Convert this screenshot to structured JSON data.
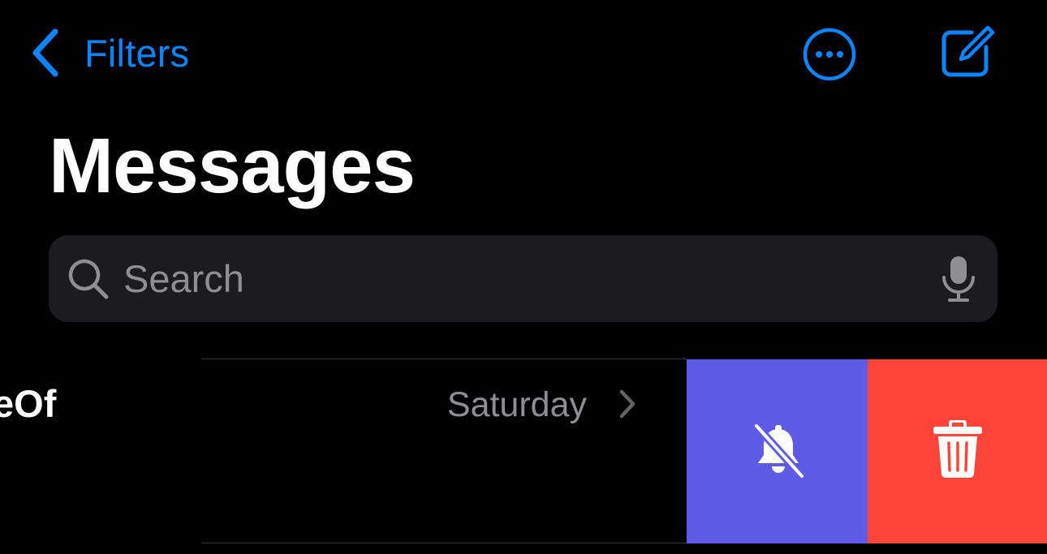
{
  "navigation": {
    "back_label": "Filters",
    "back_icon": "chevron-left-icon",
    "more_icon": "ellipsis-circle-icon",
    "compose_icon": "square-and-pencil-icon",
    "accent_color": "#0a84ff"
  },
  "header": {
    "title": "Messages"
  },
  "search": {
    "placeholder": "Search",
    "value": "",
    "icon": "magnifyingglass-icon",
    "mic_icon": "mic-icon"
  },
  "conversations": [
    {
      "name": "eOf",
      "date": "Saturday",
      "chevron_icon": "chevron-right-icon"
    }
  ],
  "swipe_actions": {
    "mute": {
      "icon": "bell-slash-icon",
      "color": "#5e5ce6"
    },
    "delete": {
      "icon": "trash-icon",
      "color": "#ff453a"
    }
  }
}
